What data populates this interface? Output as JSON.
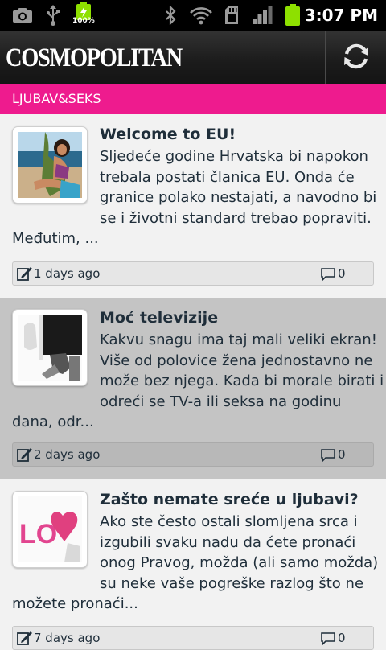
{
  "status_bar": {
    "battery_label": "100%",
    "time": "3:07 PM",
    "icons": [
      "camera-icon",
      "usb-icon",
      "battery-charging-icon",
      "bluetooth-icon",
      "wifi-icon",
      "sd-card-icon",
      "signal-icon",
      "battery-icon"
    ]
  },
  "header": {
    "logo": "COSMOPOLITAN",
    "refresh_icon": "refresh-icon"
  },
  "category": {
    "label": "LJUBAV&SEKS"
  },
  "articles": [
    {
      "title": "Welcome to EU!",
      "lines": [
        "Sljedeće godine Hrvatska bi napokon",
        "trebala postati članica EU. Onda će",
        "granice polako nestajati, a navodno bi",
        "se i životni standard trebao popraviti.",
        "Međutim, ..."
      ],
      "date": "1 days ago",
      "comments": "0",
      "selected": false
    },
    {
      "title": "Moć televizije",
      "lines": [
        "Kakvu snagu ima taj mali veliki ekran!",
        "Više od polovice žena jednostavno ne",
        "može bez njega. Kada bi morale birati i",
        "odreći se TV-a ili seksa na godinu",
        "dana, odr..."
      ],
      "date": "2 days ago",
      "comments": "0",
      "selected": true
    },
    {
      "title": "Zašto nemate sreće u ljubavi?",
      "lines": [
        "Ako ste često ostali slomljena srca i",
        "izgubili svaku nadu da ćete pronaći",
        "onog Pravog, možda (ali samo možda)",
        "su neke vaše pogreške razlog što ne",
        "možete pronaći..."
      ],
      "date": "7 days ago",
      "comments": "0",
      "selected": false
    }
  ],
  "colors": {
    "category_bar": "#ee1b8e",
    "selected_row": "#c4c4c4",
    "list_bg": "#f2f2f2",
    "text": "#1f2e3a"
  }
}
